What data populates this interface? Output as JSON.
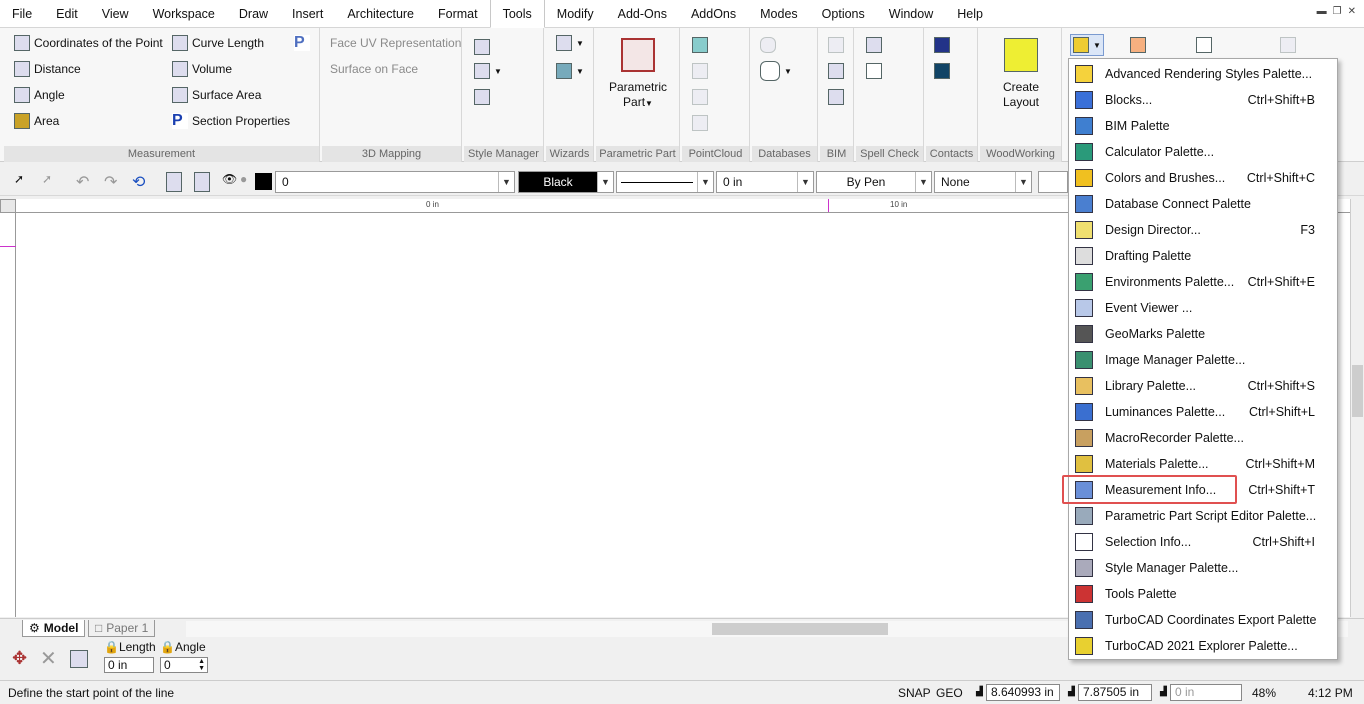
{
  "menubar": {
    "items": [
      "File",
      "Edit",
      "View",
      "Workspace",
      "Draw",
      "Insert",
      "Architecture",
      "Format",
      "Tools",
      "Modify",
      "Add-Ons",
      "AddOns",
      "Modes",
      "Options",
      "Window",
      "Help"
    ],
    "active": "Tools"
  },
  "ribbon": {
    "measurement": {
      "label": "Measurement",
      "coordinates": "Coordinates of the Point",
      "distance": "Distance",
      "angle": "Angle",
      "area": "Area",
      "curve_length": "Curve Length",
      "volume": "Volume",
      "surface_area": "Surface Area",
      "section_properties": "Section Properties"
    },
    "mapping3d": {
      "label": "3D Mapping",
      "face_uv": "Face UV Representation",
      "surface_on_face": "Surface on Face"
    },
    "style_manager": "Style Manager",
    "wizards": "Wizards",
    "parametric": {
      "label": "Parametric Part",
      "button_line1": "Parametric",
      "button_line2": "Part"
    },
    "pointcloud": "PointCloud",
    "databases": "Databases",
    "bim": "BIM",
    "spellcheck": "Spell Check",
    "contacts": "Contacts",
    "woodworking": {
      "label": "WoodWorking",
      "button_line1": "Create",
      "button_line2": "Layout"
    }
  },
  "toolbar": {
    "layer_value": "0",
    "color_value": "Black",
    "width_value": "0 in",
    "pen_value": "By Pen",
    "fill_value": "None"
  },
  "ruler": {
    "mark_zero": "0 in",
    "mark_ten": "10 in"
  },
  "tabs": {
    "model": "Model",
    "paper": "Paper 1"
  },
  "inputbar": {
    "length_label": "Length",
    "angle_label": "Angle",
    "length_value": "0 in",
    "angle_value": "0"
  },
  "statusbar": {
    "prompt": "Define the start point of the line",
    "snap": "SNAP",
    "geo": "GEO",
    "x_value": "8.640993 in",
    "y_value": "7.87505 in",
    "z_value": "0 in",
    "zoom": "48%",
    "time": "4:12 PM"
  },
  "palette_menu": [
    {
      "label": "Advanced Rendering Styles Palette...",
      "shortcut": ""
    },
    {
      "label": "Blocks...",
      "shortcut": "Ctrl+Shift+B"
    },
    {
      "label": "BIM Palette",
      "shortcut": ""
    },
    {
      "label": "Calculator Palette...",
      "shortcut": ""
    },
    {
      "label": "Colors and Brushes...",
      "shortcut": "Ctrl+Shift+C"
    },
    {
      "label": "Database Connect Palette",
      "shortcut": ""
    },
    {
      "label": "Design Director...",
      "shortcut": "F3"
    },
    {
      "label": "Drafting Palette",
      "shortcut": ""
    },
    {
      "label": "Environments Palette...",
      "shortcut": "Ctrl+Shift+E"
    },
    {
      "label": "Event Viewer ...",
      "shortcut": ""
    },
    {
      "label": "GeoMarks Palette",
      "shortcut": ""
    },
    {
      "label": "Image Manager Palette...",
      "shortcut": ""
    },
    {
      "label": "Library Palette...",
      "shortcut": "Ctrl+Shift+S"
    },
    {
      "label": "Luminances Palette...",
      "shortcut": "Ctrl+Shift+L"
    },
    {
      "label": "MacroRecorder Palette...",
      "shortcut": ""
    },
    {
      "label": "Materials Palette...",
      "shortcut": "Ctrl+Shift+M"
    },
    {
      "label": "Measurement Info...",
      "shortcut": "Ctrl+Shift+T"
    },
    {
      "label": "Parametric Part Script Editor Palette...",
      "shortcut": ""
    },
    {
      "label": "Selection Info...",
      "shortcut": "Ctrl+Shift+I"
    },
    {
      "label": "Style Manager Palette...",
      "shortcut": ""
    },
    {
      "label": "Tools Palette",
      "shortcut": ""
    },
    {
      "label": "TurboCAD Coordinates Export Palette",
      "shortcut": ""
    },
    {
      "label": "TurboCAD 2021 Explorer Palette...",
      "shortcut": ""
    }
  ],
  "colors": {
    "highlight": "#e05050",
    "accent_magenta": "#cc33cc"
  }
}
